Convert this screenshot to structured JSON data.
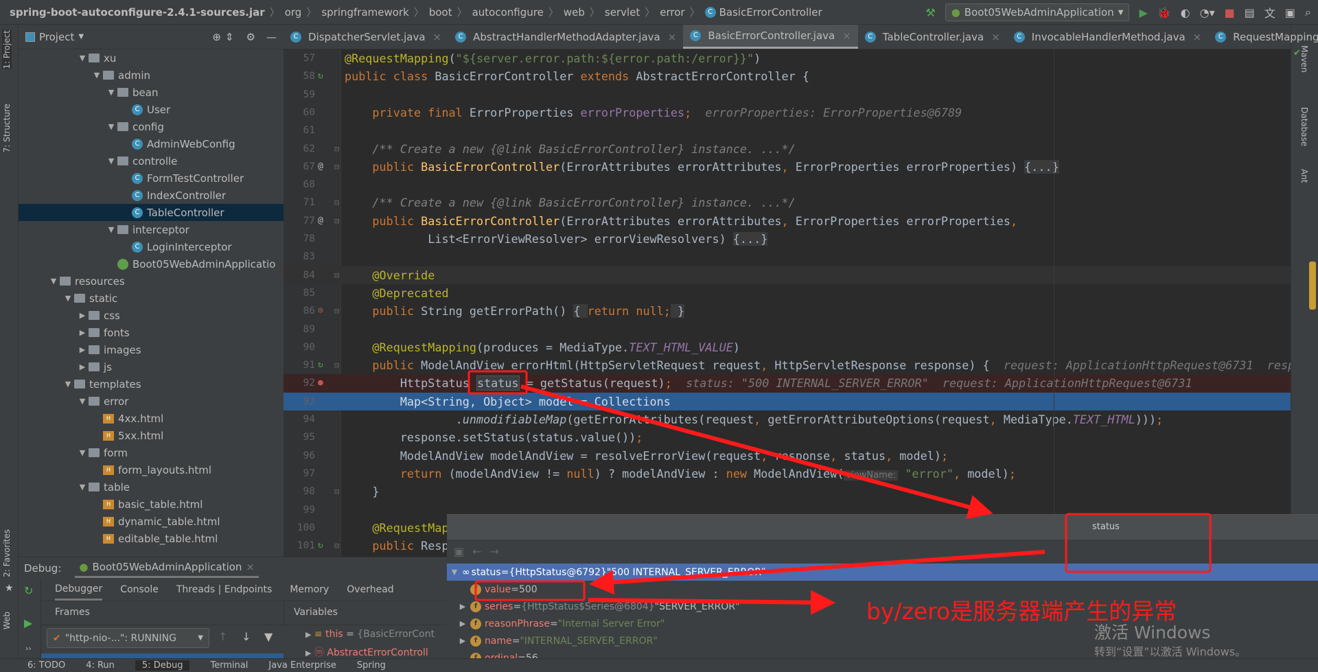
{
  "breadcrumb": [
    "spring-boot-autoconfigure-2.4.1-sources.jar",
    "org",
    "springframework",
    "boot",
    "autoconfigure",
    "web",
    "servlet",
    "error",
    "BasicErrorController"
  ],
  "run_config": "Boot05WebAdminApplication",
  "left_strip": {
    "project": "1: Project",
    "structure": "7: Structure",
    "favorites": "2: Favorites",
    "web": "Web"
  },
  "right_strip": {
    "maven": "Maven",
    "database": "Database",
    "ant": "Ant"
  },
  "project_panel": {
    "title": "Project"
  },
  "tree": [
    {
      "label": "xu",
      "level": 2,
      "type": "folder",
      "open": true
    },
    {
      "label": "admin",
      "level": 3,
      "type": "folder",
      "open": true
    },
    {
      "label": "bean",
      "level": 4,
      "type": "folder",
      "open": true
    },
    {
      "label": "User",
      "level": 5,
      "type": "class"
    },
    {
      "label": "config",
      "level": 4,
      "type": "folder",
      "open": true
    },
    {
      "label": "AdminWebConfig",
      "level": 5,
      "type": "class"
    },
    {
      "label": "controlle",
      "level": 4,
      "type": "folder",
      "open": true
    },
    {
      "label": "FormTestController",
      "level": 5,
      "type": "class"
    },
    {
      "label": "IndexController",
      "level": 5,
      "type": "class"
    },
    {
      "label": "TableController",
      "level": 5,
      "type": "class",
      "selected": true
    },
    {
      "label": "interceptor",
      "level": 4,
      "type": "folder",
      "open": true
    },
    {
      "label": "LoginInterceptor",
      "level": 5,
      "type": "class"
    },
    {
      "label": "Boot05WebAdminApplicatio",
      "level": 4,
      "type": "app"
    },
    {
      "label": "resources",
      "level": 0,
      "type": "folder",
      "open": true
    },
    {
      "label": "static",
      "level": 1,
      "type": "folder",
      "open": true
    },
    {
      "label": "css",
      "level": 2,
      "type": "folder",
      "open": false
    },
    {
      "label": "fonts",
      "level": 2,
      "type": "folder",
      "open": false
    },
    {
      "label": "images",
      "level": 2,
      "type": "folder",
      "open": false
    },
    {
      "label": "js",
      "level": 2,
      "type": "folder",
      "open": false
    },
    {
      "label": "templates",
      "level": 1,
      "type": "folder",
      "open": true
    },
    {
      "label": "error",
      "level": 2,
      "type": "folder",
      "open": true
    },
    {
      "label": "4xx.html",
      "level": 3,
      "type": "html"
    },
    {
      "label": "5xx.html",
      "level": 3,
      "type": "html"
    },
    {
      "label": "form",
      "level": 2,
      "type": "folder",
      "open": true
    },
    {
      "label": "form_layouts.html",
      "level": 3,
      "type": "html"
    },
    {
      "label": "table",
      "level": 2,
      "type": "folder",
      "open": true
    },
    {
      "label": "basic_table.html",
      "level": 3,
      "type": "html"
    },
    {
      "label": "dynamic_table.html",
      "level": 3,
      "type": "html"
    },
    {
      "label": "editable_table.html",
      "level": 3,
      "type": "html"
    }
  ],
  "tabs": [
    {
      "label": "DispatcherServlet.java"
    },
    {
      "label": "AbstractHandlerMethodAdapter.java"
    },
    {
      "label": "BasicErrorController.java",
      "active": true
    },
    {
      "label": "TableController.java"
    },
    {
      "label": "InvocableHandlerMethod.java"
    },
    {
      "label": "RequestMapping"
    }
  ],
  "code": [
    {
      "n": "57",
      "seg": [
        [
          "ann",
          "@RequestMapping"
        ],
        [
          "p",
          "("
        ],
        [
          "str",
          "\"${server.error.path:${error.path:/error}}\""
        ],
        [
          "p",
          ")"
        ]
      ]
    },
    {
      "n": "58",
      "icon": "run",
      "seg": [
        [
          "kw",
          "public class "
        ],
        [
          "p",
          "BasicErrorController "
        ],
        [
          "kw",
          "extends "
        ],
        [
          "p",
          "AbstractErrorController {"
        ]
      ]
    },
    {
      "n": "59",
      "seg": []
    },
    {
      "n": "60",
      "seg": [
        [
          "p",
          "    "
        ],
        [
          "kw",
          "private final "
        ],
        [
          "p",
          "ErrorProperties "
        ],
        [
          "fld",
          "errorProperties"
        ],
        [
          "kw",
          ";"
        ],
        [
          "hint",
          "  errorProperties: ErrorProperties@6789"
        ]
      ]
    },
    {
      "n": "61",
      "seg": []
    },
    {
      "n": "62",
      "fold": true,
      "seg": [
        [
          "p",
          "    "
        ],
        [
          "cmt",
          "/** Create a new {@link BasicErrorController} instance. ...*/"
        ]
      ]
    },
    {
      "n": "67",
      "icon": "at",
      "fold": true,
      "seg": [
        [
          "p",
          "    "
        ],
        [
          "kw",
          "public "
        ],
        [
          "mth",
          "BasicErrorController"
        ],
        [
          "p",
          "(ErrorAttributes errorAttributes"
        ],
        [
          "kw",
          ","
        ],
        [
          "p",
          " ErrorProperties errorProperties) "
        ],
        [
          "fold",
          "{...}"
        ]
      ]
    },
    {
      "n": "68",
      "seg": []
    },
    {
      "n": "71",
      "fold": true,
      "seg": [
        [
          "p",
          "    "
        ],
        [
          "cmt",
          "/** Create a new {@link BasicErrorController} instance. ...*/"
        ]
      ]
    },
    {
      "n": "77",
      "icon": "at",
      "fold": true,
      "seg": [
        [
          "p",
          "    "
        ],
        [
          "kw",
          "public "
        ],
        [
          "mth",
          "BasicErrorController"
        ],
        [
          "p",
          "(ErrorAttributes errorAttributes"
        ],
        [
          "kw",
          ","
        ],
        [
          "p",
          " ErrorProperties errorProperties"
        ],
        [
          "kw",
          ","
        ]
      ]
    },
    {
      "n": "78",
      "seg": [
        [
          "p",
          "            List<ErrorViewResolver> errorViewResolvers) "
        ],
        [
          "fold",
          "{...}"
        ]
      ]
    },
    {
      "n": "83",
      "seg": []
    },
    {
      "n": "84",
      "cur": true,
      "fold": true,
      "seg": [
        [
          "p",
          "    "
        ],
        [
          "ann",
          "@Override"
        ]
      ]
    },
    {
      "n": "85",
      "seg": [
        [
          "p",
          "    "
        ],
        [
          "ann",
          "@Deprecated"
        ]
      ]
    },
    {
      "n": "86",
      "icon": "override",
      "fold": true,
      "seg": [
        [
          "p",
          "    "
        ],
        [
          "kw",
          "public "
        ],
        [
          "p",
          "String getErrorPath() "
        ],
        [
          "fold",
          "{ "
        ],
        [
          "kw",
          "return null;"
        ],
        [
          "fold",
          " }"
        ]
      ]
    },
    {
      "n": "89",
      "seg": []
    },
    {
      "n": "90",
      "seg": [
        [
          "p",
          "    "
        ],
        [
          "ann",
          "@RequestMapping"
        ],
        [
          "p",
          "(produces = MediaType."
        ],
        [
          "stat",
          "TEXT_HTML_VALUE"
        ],
        [
          "p",
          ")"
        ]
      ]
    },
    {
      "n": "91",
      "icon": "run",
      "fold": true,
      "seg": [
        [
          "p",
          "    "
        ],
        [
          "kw",
          "public "
        ],
        [
          "p",
          "ModelAndView errorHtml(HttpServletRequest request"
        ],
        [
          "kw",
          ","
        ],
        [
          "p",
          " HttpServletResponse response) {"
        ],
        [
          "hint",
          "  request: ApplicationHttpRequest@6731  respons"
        ]
      ]
    },
    {
      "n": "92",
      "icon": "breakpoint",
      "bp": true,
      "seg": [
        [
          "p",
          "        HttpStatus "
        ],
        [
          "hl",
          "status"
        ],
        [
          "p",
          " = getStatus(request)"
        ],
        [
          "kw",
          ";"
        ],
        [
          "hint",
          "  status: \"500 INTERNAL_SERVER_ERROR\"  request: ApplicationHttpRequest@6731"
        ]
      ]
    },
    {
      "n": "93",
      "exe": true,
      "seg": [
        [
          "p",
          "        Map<String"
        ],
        [
          "kw",
          ","
        ],
        [
          "p",
          " Object> model = Collections"
        ]
      ]
    },
    {
      "n": "94",
      "seg": [
        [
          "p",
          "                ."
        ],
        [
          "it",
          "unmodifiableMap"
        ],
        [
          "p",
          "(getErrorAttributes(request"
        ],
        [
          "kw",
          ","
        ],
        [
          "p",
          " getErrorAttributeOptions(request"
        ],
        [
          "kw",
          ","
        ],
        [
          "p",
          " MediaType."
        ],
        [
          "stat",
          "TEXT_HTML"
        ],
        [
          "p",
          ")))"
        ],
        [
          "kw",
          ";"
        ]
      ]
    },
    {
      "n": "95",
      "seg": [
        [
          "p",
          "        response.setStatus(status.value())"
        ],
        [
          "kw",
          ";"
        ]
      ]
    },
    {
      "n": "96",
      "seg": [
        [
          "p",
          "        ModelAndView modelAndView = resolveErrorView(request"
        ],
        [
          "kw",
          ","
        ],
        [
          "p",
          " response"
        ],
        [
          "kw",
          ","
        ],
        [
          "p",
          " status"
        ],
        [
          "kw",
          ","
        ],
        [
          "p",
          " model)"
        ],
        [
          "kw",
          ";"
        ]
      ]
    },
    {
      "n": "97",
      "seg": [
        [
          "p",
          "        "
        ],
        [
          "kw",
          "return "
        ],
        [
          "p",
          "(modelAndView != "
        ],
        [
          "kw",
          "null"
        ],
        [
          "p",
          ") ? modelAndView : "
        ],
        [
          "kw",
          "new "
        ],
        [
          "p",
          "ModelAndView("
        ],
        [
          "box",
          "viewName:"
        ],
        [
          "str",
          " \"error\""
        ],
        [
          "kw",
          ","
        ],
        [
          "p",
          " model)"
        ],
        [
          "kw",
          ";"
        ]
      ]
    },
    {
      "n": "98",
      "fold": true,
      "seg": [
        [
          "p",
          "    }"
        ]
      ]
    },
    {
      "n": "99",
      "seg": []
    },
    {
      "n": "100",
      "seg": [
        [
          "p",
          "    "
        ],
        [
          "ann",
          "@RequestMap"
        ]
      ]
    },
    {
      "n": "101",
      "icon": "run",
      "fold": true,
      "seg": [
        [
          "p",
          "    "
        ],
        [
          "kw",
          "public "
        ],
        [
          "p",
          "Resp"
        ]
      ]
    }
  ],
  "debug": {
    "label": "Debug:",
    "session": "Boot05WebAdminApplication",
    "tabs": [
      "Debugger",
      "Console",
      "Threads | Endpoints",
      "Memory",
      "Overhead"
    ],
    "frames_label": "Frames",
    "variables_label": "Variables",
    "thread": "\"http-nio-...\": RUNNING",
    "variables": [
      {
        "name": "this",
        "value": "{BasicErrorCont"
      },
      {
        "name": "AbstractErrorControll",
        "value": ""
      }
    ]
  },
  "bottom_bar": [
    "6: TODO",
    "4: Run",
    "5: Debug",
    "Terminal",
    "Java Enterprise",
    "Spring"
  ],
  "popup": {
    "title": "status",
    "rows": [
      {
        "name": "status",
        "eq": " = ",
        "type": "{HttpStatus@6792} ",
        "value": "\"500 INTERNAL_SERVER_ERROR\"",
        "selected": true,
        "expand": "open"
      },
      {
        "name": "value",
        "eq": " = ",
        "type": "",
        "value": "500",
        "expand": "none"
      },
      {
        "name": "series",
        "eq": " = ",
        "type": "{HttpStatus$Series@6804} ",
        "value": "\"SERVER_ERROR\"",
        "expand": "closed"
      },
      {
        "name": "reasonPhrase",
        "eq": " = ",
        "type": "",
        "value": "\"Internal Server Error\"",
        "expand": "closed",
        "str": true
      },
      {
        "name": "name",
        "eq": " = ",
        "type": "",
        "value": "\"INTERNAL_SERVER_ERROR\"",
        "expand": "closed",
        "str": true
      },
      {
        "name": "ordinal",
        "eq": " = ",
        "type": "",
        "value": "56",
        "expand": "none"
      }
    ]
  },
  "annotation": {
    "text": "by/zero是服务器端产生的异常",
    "color": "#ff1a1a"
  },
  "watermark": {
    "line1": "激活 Windows",
    "line2": "转到“设置”以激活 Windows。"
  }
}
